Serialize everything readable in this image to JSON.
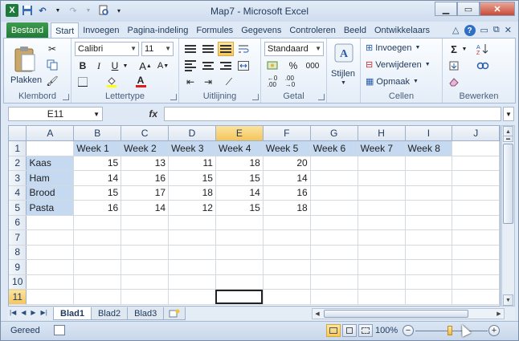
{
  "window": {
    "title": "Map7 - Microsoft Excel"
  },
  "ribbon": {
    "file_tab": "Bestand",
    "tabs": [
      "Start",
      "Invoegen",
      "Pagina-indeling",
      "Formules",
      "Gegevens",
      "Controleren",
      "Beeld",
      "Ontwikkelaars"
    ],
    "active_tab": "Start",
    "clipboard": {
      "paste_label": "Plakken",
      "group_label": "Klembord"
    },
    "font": {
      "name": "Calibri",
      "size": "11",
      "group_label": "Lettertype",
      "bold": "B",
      "italic": "I",
      "underline": "U"
    },
    "alignment": {
      "group_label": "Uitlijning"
    },
    "number": {
      "format": "Standaard",
      "percent": "%",
      "thousands": "000",
      "group_label": "Getal"
    },
    "styles": {
      "label": "Stijlen"
    },
    "cells": {
      "insert": "Invoegen",
      "delete": "Verwijderen",
      "format": "Opmaak",
      "group_label": "Cellen"
    },
    "editing": {
      "sigma": "Σ",
      "group_label": "Bewerken"
    }
  },
  "formula_bar": {
    "name_box": "E11",
    "fx": "fx",
    "value": ""
  },
  "sheet": {
    "columns": [
      "A",
      "B",
      "C",
      "D",
      "E",
      "F",
      "G",
      "H",
      "I",
      "J"
    ],
    "active_column": "E",
    "active_row": 11,
    "header_row": [
      "",
      "Week 1",
      "Week 2",
      "Week 3",
      "Week 4",
      "Week 5",
      "Week 6",
      "Week 7",
      "Week 8",
      ""
    ],
    "rows": [
      [
        "Kaas",
        "15",
        "13",
        "11",
        "18",
        "20",
        "",
        "",
        "",
        ""
      ],
      [
        "Ham",
        "14",
        "16",
        "15",
        "15",
        "14",
        "",
        "",
        "",
        ""
      ],
      [
        "Brood",
        "15",
        "17",
        "18",
        "14",
        "16",
        "",
        "",
        "",
        ""
      ],
      [
        "Pasta",
        "16",
        "14",
        "12",
        "15",
        "18",
        "",
        "",
        "",
        ""
      ]
    ],
    "row_numbers": [
      "1",
      "2",
      "3",
      "4",
      "5",
      "6",
      "7",
      "8",
      "9",
      "10",
      "11"
    ]
  },
  "sheet_tabs": {
    "tabs": [
      "Blad1",
      "Blad2",
      "Blad3"
    ],
    "active": "Blad1"
  },
  "status_bar": {
    "ready": "Gereed",
    "zoom": "100%",
    "zoom_out": "−",
    "zoom_in": "+"
  }
}
